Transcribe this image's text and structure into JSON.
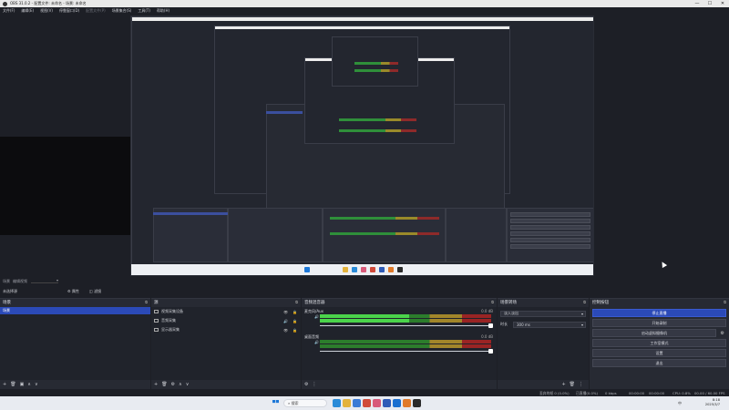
{
  "window": {
    "title": "OBS 31.0.2 - 配置文件: 未命名 - 场景: 未命名",
    "controls": [
      "—",
      "☐",
      "✕"
    ]
  },
  "menu": [
    {
      "label": "文件(F)",
      "dim": false
    },
    {
      "label": "编辑(E)",
      "dim": false
    },
    {
      "label": "视图(V)",
      "dim": false
    },
    {
      "label": "停靠窗口(D)",
      "dim": false
    },
    {
      "label": "配置文件(P)",
      "dim": true
    },
    {
      "label": "场景集合(S)",
      "dim": false
    },
    {
      "label": "工具(T)",
      "dim": false
    },
    {
      "label": "帮助(H)",
      "dim": false
    }
  ],
  "scene_info": {
    "label": "场景",
    "value": "编辑视频"
  },
  "filter_bar": {
    "scene_name": "未选择源",
    "btn_properties": "属性",
    "btn_filters": "滤镜"
  },
  "docks": {
    "scenes": {
      "title": "场景",
      "items": [
        "场景"
      ],
      "footer": [
        "+",
        "🗑",
        "▣",
        "∧",
        "∨"
      ]
    },
    "sources": {
      "title": "源",
      "items": [
        {
          "label": "视频采集设备",
          "icon": "camera-icon"
        },
        {
          "label": "音频采集",
          "icon": "mic-icon"
        },
        {
          "label": "显示器采集",
          "icon": "monitor-icon"
        }
      ],
      "footer": [
        "+",
        "🗑",
        "⚙",
        "∧",
        "∨"
      ]
    },
    "mixer": {
      "title": "音频混音器",
      "channels": [
        {
          "label": "麦克风/Aux",
          "db": "0.0 dB",
          "level": 0.52
        },
        {
          "label": "桌面音频",
          "db": "0.0 dB",
          "level": 0.0
        }
      ],
      "footer": [
        "⚙",
        "⋮"
      ]
    },
    "transitions": {
      "title": "场景转场",
      "transition": "淡入淡出",
      "duration_label": "时长",
      "duration": "300 ms",
      "footer": [
        "+",
        "🗑",
        "⋮"
      ]
    },
    "controls": {
      "title": "控制按钮",
      "buttons": [
        {
          "label": "停止直播",
          "primary": true
        },
        {
          "label": "开始录制",
          "primary": false
        },
        {
          "label": "启动虚拟摄像机",
          "primary": false
        },
        {
          "label": "工作室模式",
          "primary": false
        },
        {
          "label": "设置",
          "primary": false
        },
        {
          "label": "退出",
          "primary": false
        }
      ]
    }
  },
  "status": {
    "dropped": "丢弃的帧 0 (0.0%)",
    "live_time": "已直播(0.0%)",
    "bitrate": "0 kbps",
    "live": "00:00:00",
    "rec": "00:00:00",
    "cpu": "CPU: 0.8%",
    "fps": "00.00 / 60.00 FPS"
  },
  "taskbar": {
    "search": "搜索",
    "tray": "中",
    "time": "8:18",
    "date": "2025/3/7",
    "icons": [
      {
        "name": "edge-icon",
        "color": "#2a8bd8"
      },
      {
        "name": "explorer-icon",
        "color": "#e3b23c"
      },
      {
        "name": "store-icon",
        "color": "#3b7bd6"
      },
      {
        "name": "app-red-icon",
        "color": "#d04a3a"
      },
      {
        "name": "app-pink-icon",
        "color": "#d85a7a"
      },
      {
        "name": "word-icon",
        "color": "#2f5bb7"
      },
      {
        "name": "outlook-icon",
        "color": "#1a6fd0"
      },
      {
        "name": "app-orange-icon",
        "color": "#e07a2a"
      },
      {
        "name": "obs-icon",
        "color": "#2b2b2b"
      }
    ]
  }
}
